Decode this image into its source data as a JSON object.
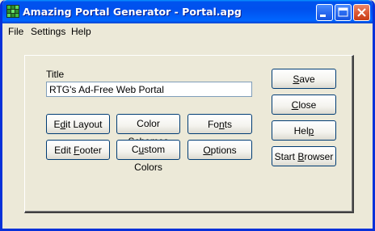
{
  "window": {
    "title": "Amazing Portal Generator - Portal.apg"
  },
  "menu": {
    "items": [
      {
        "label": "File"
      },
      {
        "label": "Settings"
      },
      {
        "label": "Help"
      }
    ]
  },
  "form": {
    "title_label": "Title",
    "title_value": "RTG's Ad-Free Web Portal"
  },
  "buttons": {
    "edit_layout": {
      "pre": "E",
      "acc": "d",
      "post": "it Layout"
    },
    "color_schemes": {
      "pre": "Color Sche",
      "acc": "m",
      "post": "es"
    },
    "fonts": {
      "pre": "Fo",
      "acc": "n",
      "post": "ts"
    },
    "edit_footer": {
      "pre": "Edit ",
      "acc": "F",
      "post": "ooter"
    },
    "custom_colors": {
      "pre": "C",
      "acc": "u",
      "post": "stom Colors"
    },
    "options": {
      "pre": "",
      "acc": "O",
      "post": "ptions"
    },
    "save": {
      "pre": "",
      "acc": "S",
      "post": "ave"
    },
    "close": {
      "pre": "",
      "acc": "C",
      "post": "lose"
    },
    "help": {
      "pre": "Hel",
      "acc": "p",
      "post": ""
    },
    "start_browser": {
      "pre": "Start ",
      "acc": "B",
      "post": "rowser"
    }
  },
  "colors": {
    "titlebar": "#0054e3",
    "frame": "#0831d9",
    "dialog_bg": "#ece9d8",
    "button_border": "#003c74"
  },
  "icons": {
    "app": "grid-app-icon",
    "minimize": "minimize-icon",
    "maximize": "maximize-icon",
    "close": "close-icon"
  }
}
